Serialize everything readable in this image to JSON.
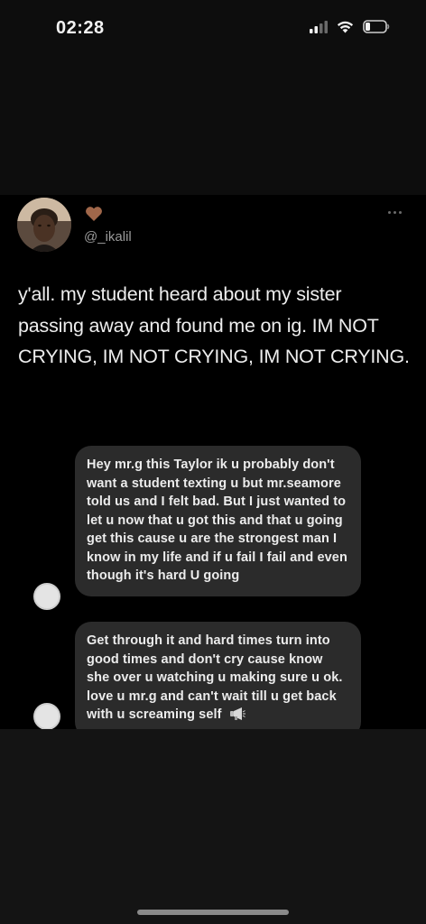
{
  "status_bar": {
    "time": "02:28"
  },
  "post": {
    "username": "@_ikalil",
    "text": "y'all. my student heard about my sister passing away and found me on ig. IM NOT CRYING, IM NOT CRYING, IM NOT CRYING."
  },
  "messages": [
    {
      "text": "Hey mr.g this Taylor ik u probably don't want a student texting u but mr.seamore told us and I felt bad. But I just wanted to let u now that u got this and that u going get this cause u are the strongest man I know in my life and if u fail I fail and even though it's hard U going"
    },
    {
      "text": "Get through it and hard times turn into good times and don't cry cause know she over u watching u making sure u ok. love u mr.g and can't wait till u get back with u screaming self",
      "emoji": "📢"
    }
  ],
  "icons": {
    "signal": "signal-icon",
    "wifi": "wifi-icon",
    "battery": "battery-icon",
    "heart": "brown-heart-icon",
    "more": "more-icon",
    "megaphone": "megaphone-icon"
  },
  "colors": {
    "background": "#0d0d0d",
    "card": "#000000",
    "bubble": "#2b2b2b",
    "heart": "#a0674a"
  }
}
